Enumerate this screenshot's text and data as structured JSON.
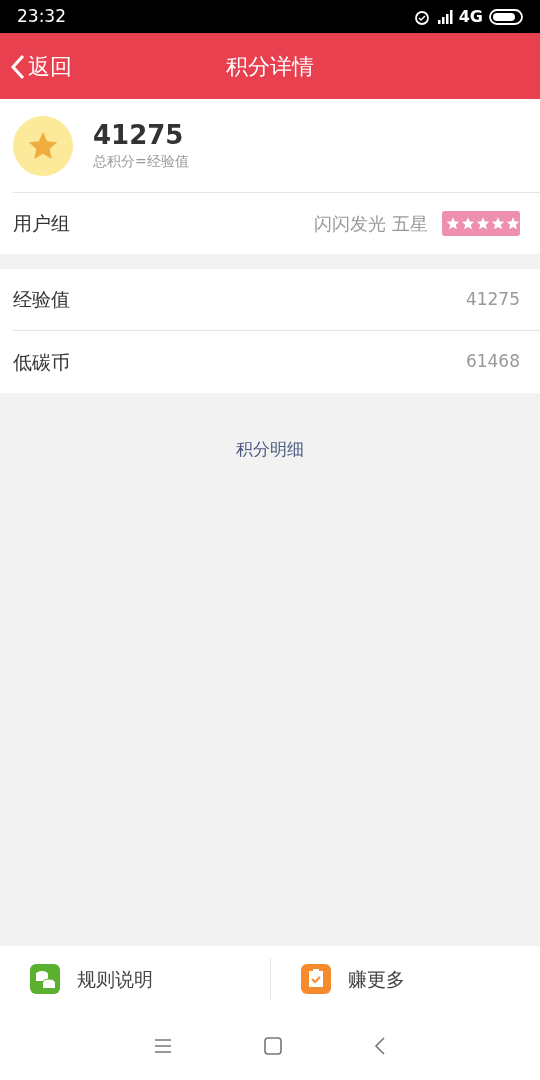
{
  "status_bar": {
    "time": "23:32",
    "network": "4G"
  },
  "header": {
    "back": "返回",
    "title": "积分详情"
  },
  "summary": {
    "points": "41275",
    "caption": "总积分=经验值"
  },
  "user_group": {
    "label": "用户组",
    "value": "闪闪发光 五星"
  },
  "rows": [
    {
      "label": "经验值",
      "value": "41275"
    },
    {
      "label": "低碳币",
      "value": "61468"
    }
  ],
  "detail_link": "积分明细",
  "bottom_actions": [
    {
      "kind": "rules",
      "label": "规则说明"
    },
    {
      "kind": "earn",
      "label": "赚更多"
    }
  ]
}
